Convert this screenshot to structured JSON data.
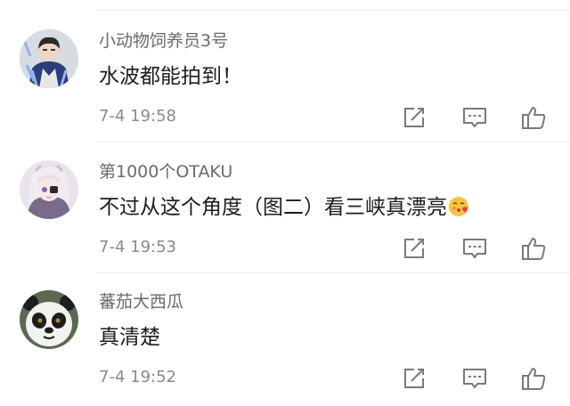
{
  "comments": [
    {
      "username": "小动物饲养员3号",
      "text": "水波都能拍到！",
      "time": "7-4 19:58",
      "avatar": "avatar-person-icon"
    },
    {
      "username": "第1000个OTAKU",
      "text": "不过从这个角度（图二）看三峡真漂亮",
      "emoji": "blowing-kiss-emoji",
      "time": "7-4 19:53",
      "avatar": "avatar-anime-icon"
    },
    {
      "username": "蕃茄大西瓜",
      "text": "真清楚",
      "time": "7-4 19:52",
      "avatar": "avatar-panda-icon"
    }
  ],
  "icons": {
    "share": "share-icon",
    "reply": "comment-icon",
    "like": "thumbs-up-icon"
  },
  "colors": {
    "username": "#6b6b6b",
    "text": "#1c1c1c",
    "timestamp": "#8a8a8a",
    "icon": "#7a7a7a",
    "divider": "#eeeeee"
  }
}
